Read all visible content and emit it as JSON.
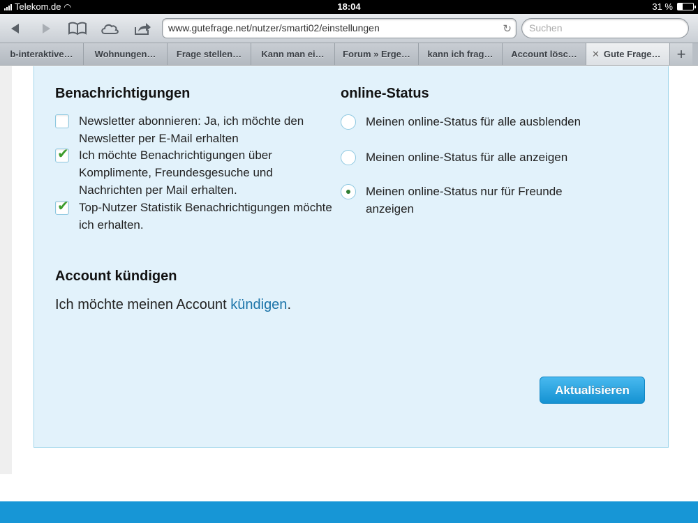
{
  "status_bar": {
    "carrier": "Telekom.de",
    "time": "18:04",
    "battery": "31 %",
    "battery_level": 0.31
  },
  "toolbar": {
    "url": "www.gutefrage.net/nutzer/smarti02/einstellungen",
    "search_placeholder": "Suchen"
  },
  "tabs": [
    {
      "label": "b-interaktive…"
    },
    {
      "label": "Wohnungen…"
    },
    {
      "label": "Frage stellen…"
    },
    {
      "label": "Kann man ei…"
    },
    {
      "label": "Forum » Erge…"
    },
    {
      "label": "kann ich frag…"
    },
    {
      "label": "Account lösc…"
    },
    {
      "label": "Gute Frage…"
    }
  ],
  "notifications": {
    "title": "Benachrichtigungen",
    "options": [
      {
        "label": "Newsletter abonnieren: Ja, ich möchte den Newsletter per E-Mail erhalten",
        "checked": false
      },
      {
        "label": "Ich möchte Benachrichtigungen über Komplimente, Freundesgesuche und Nachrichten per Mail erhalten.",
        "checked": true
      },
      {
        "label": "Top-Nutzer Statistik Benachrichtigungen möchte ich erhalten.",
        "checked": true
      }
    ]
  },
  "online_status": {
    "title": "online-Status",
    "options": [
      {
        "label": "Meinen online-Status für alle ausblenden",
        "selected": false
      },
      {
        "label": "Meinen online-Status für alle anzeigen",
        "selected": false
      },
      {
        "label": "Meinen online-Status nur für Freunde anzeigen",
        "selected": true
      }
    ]
  },
  "account": {
    "title": "Account kündigen",
    "text_before": "Ich möchte meinen Account ",
    "link": "kündigen",
    "text_after": "."
  },
  "submit_label": "Aktualisieren",
  "colors": {
    "panel_bg": "#e2f2fb",
    "link": "#1a73a8",
    "button": "#1592d2",
    "check": "#3c9c2c"
  }
}
